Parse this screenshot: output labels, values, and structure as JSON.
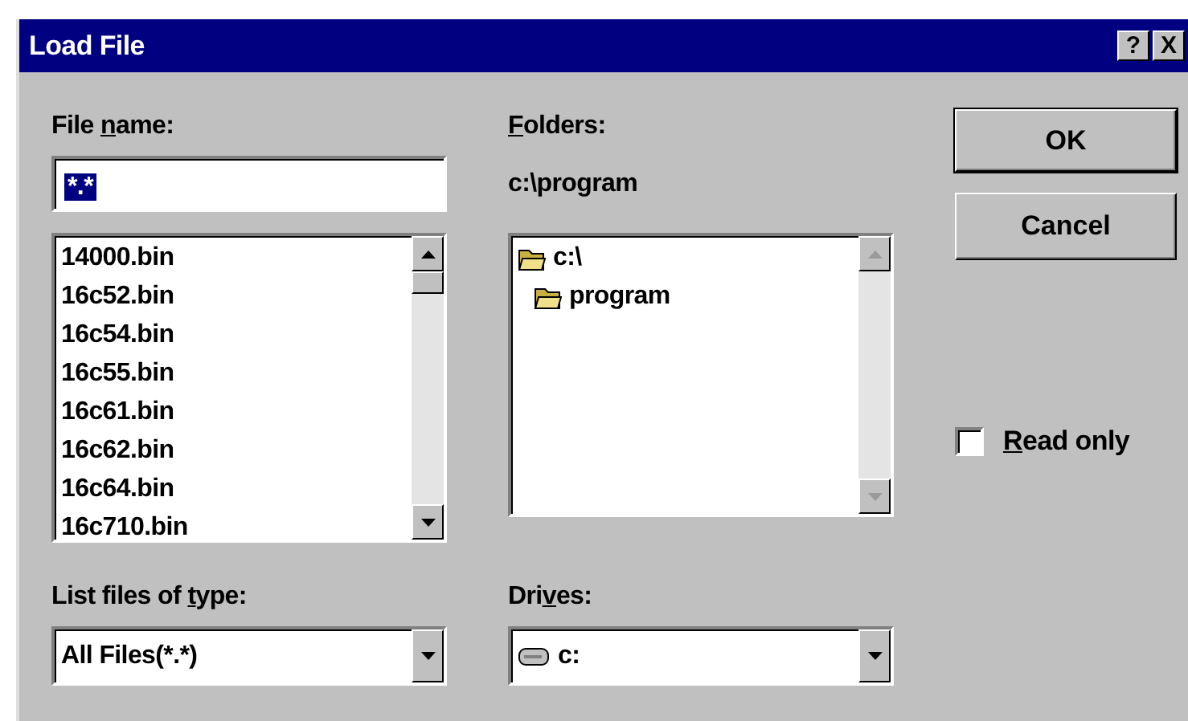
{
  "window": {
    "title": "Load File",
    "buttons": [
      "?",
      "X"
    ]
  },
  "file_name": {
    "label": {
      "before": "File ",
      "key": "n",
      "after": "ame:"
    },
    "value": "*.*",
    "selected": true
  },
  "files": {
    "items": [
      "14000.bin",
      "16c52.bin",
      "16c54.bin",
      "16c55.bin",
      "16c61.bin",
      "16c62.bin",
      "16c64.bin",
      "16c710.bin"
    ],
    "scrollbar_disabled": false
  },
  "file_type": {
    "label": {
      "before": "List files of ",
      "key": "t",
      "after": "ype:"
    },
    "value": "All Files(*.*)"
  },
  "folders": {
    "label": {
      "key": "F",
      "after": "olders:"
    },
    "path": "c:\\program",
    "items": [
      {
        "name": "c:\\",
        "children": [
          {
            "name": "program"
          }
        ]
      }
    ],
    "scrollbar_disabled": true
  },
  "drives": {
    "label": {
      "before": "Dri",
      "key": "v",
      "after": "es:"
    },
    "value": "c:"
  },
  "buttons": [
    {
      "label": "OK",
      "default": true
    },
    {
      "label": "Cancel",
      "default": false
    }
  ],
  "read_only": {
    "label": {
      "key": "R",
      "after": "ead only"
    },
    "checked": false
  }
}
